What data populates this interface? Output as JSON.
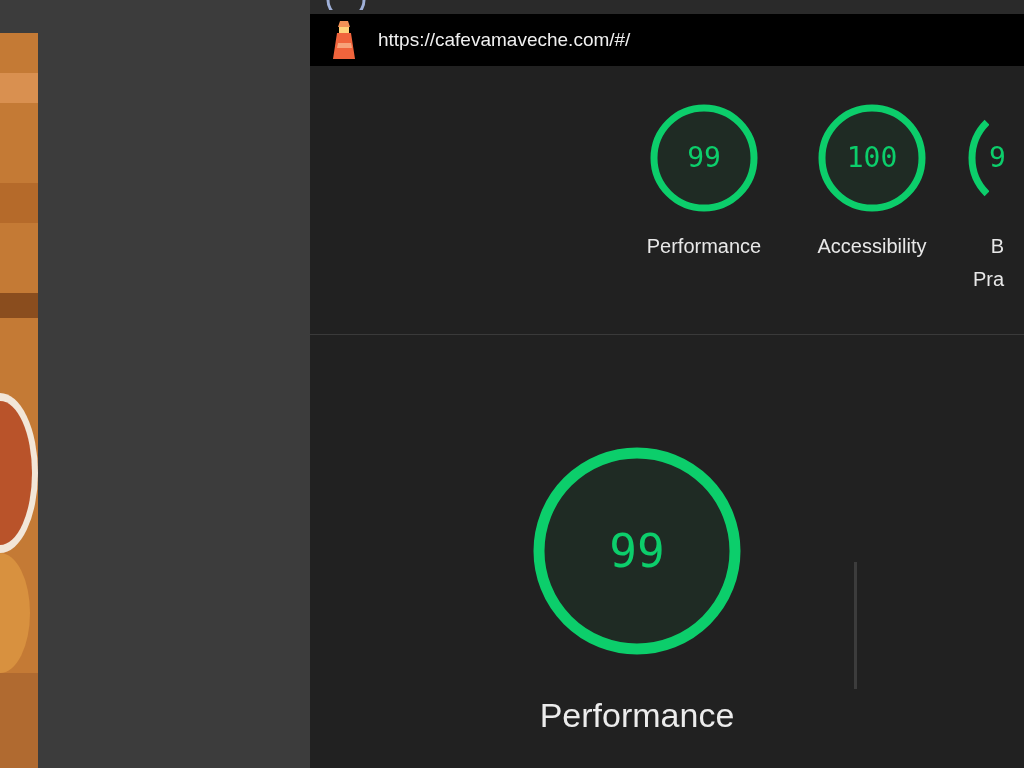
{
  "address_bar": {
    "url": "https://cafevamaveche.com/#/"
  },
  "gauges": [
    {
      "score": "99",
      "label": [
        "Performance"
      ]
    },
    {
      "score": "100",
      "label": [
        "Accessibility"
      ]
    },
    {
      "score": "9",
      "label": [
        "B",
        "Pra"
      ]
    }
  ],
  "main_gauge": {
    "score": "99",
    "label": "Performance"
  }
}
